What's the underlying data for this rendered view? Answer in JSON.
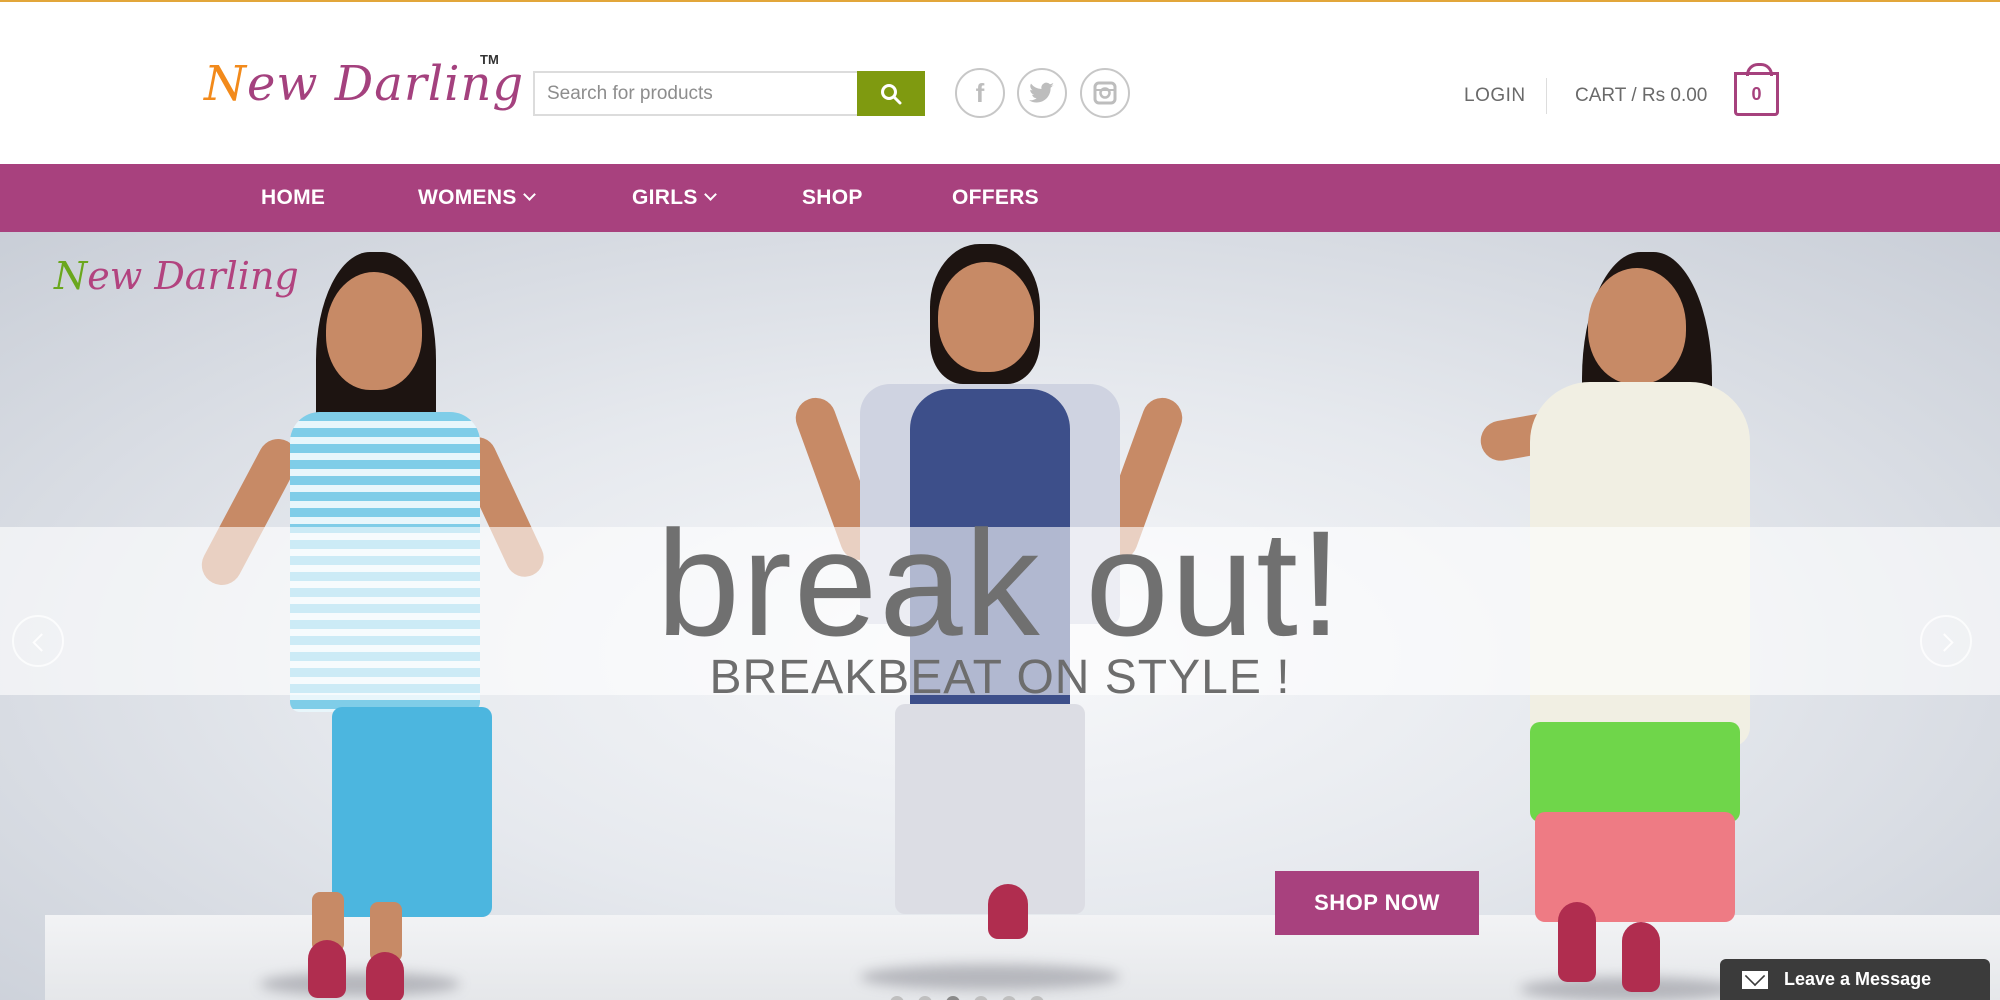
{
  "brand": {
    "name_first": "N",
    "name_rest": "ew Darling",
    "tm": "TM",
    "hero_logo_first": "N",
    "hero_logo_rest": "ew Darling",
    "accent": "#a8417e",
    "search_green": "#7f9a10"
  },
  "search": {
    "placeholder": "Search for products",
    "icon": "search-icon"
  },
  "social": [
    {
      "icon": "facebook-icon",
      "glyph": "f"
    },
    {
      "icon": "twitter-icon",
      "glyph": "t"
    },
    {
      "icon": "instagram-icon",
      "glyph": "◘"
    }
  ],
  "account": {
    "login": "LOGIN",
    "cart": "CART / Rs  0.00",
    "cart_count": "0"
  },
  "nav": {
    "home": "HOME",
    "womens": "WOMENS",
    "girls": "GIRLS",
    "shop": "SHOP",
    "offers": "OFFERS"
  },
  "hero": {
    "headline": "break out!",
    "subline": "BREAKBEAT ON STYLE !",
    "cta": "SHOP NOW"
  },
  "chat": {
    "label": "Leave a Message"
  }
}
